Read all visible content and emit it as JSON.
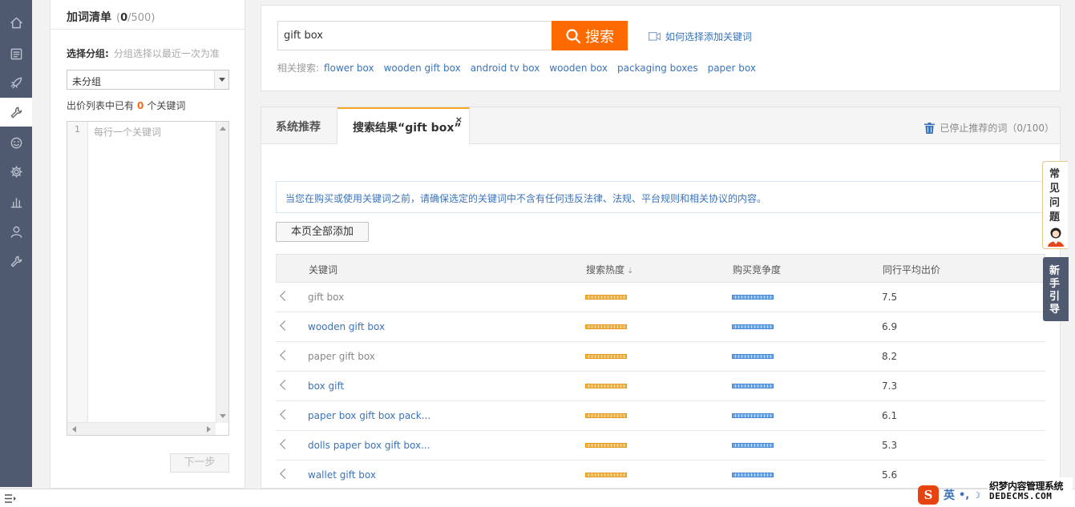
{
  "sidebar_rail": {
    "icons": [
      "home-icon",
      "list-icon",
      "rocket-icon",
      "wrench-icon",
      "face-icon",
      "gear-icon",
      "bar-chart-icon",
      "user-icon",
      "tools-icon"
    ],
    "active_index": 3
  },
  "left_panel": {
    "title": "加词清单",
    "count_open": "(",
    "count_current": "0",
    "count_total": "/500)",
    "group_label": "选择分组:",
    "group_hint": "分组选择以最近一次为准",
    "group_selected": "未分组",
    "bid_count_prefix": "出价列表中已有",
    "bid_count_value": "0",
    "bid_count_suffix": "个关键词",
    "line_number": "1",
    "keyword_placeholder": "每行一个关键词",
    "next_label": "下一步"
  },
  "search": {
    "query": "gift box",
    "button_label": "搜索",
    "help_link": "如何选择添加关键词",
    "related_label": "相关搜索:",
    "related": [
      "flower box",
      "wooden gift box",
      "android tv box",
      "wooden box",
      "packaging boxes",
      "paper box"
    ]
  },
  "tabs": {
    "recommend_label": "系统推荐",
    "results_label": "搜索结果“gift box”",
    "close_label": "×",
    "stopped_label": "已停止推荐的词（0/100）"
  },
  "notice": "当您在购买或使用关键词之前，请确保选定的关键词中不含有任何违反法律、法规、平台规则和相关协议的内容。",
  "add_all_label": "本页全部添加",
  "table": {
    "headers": {
      "keyword": "关键词",
      "heat": "搜索热度",
      "competition": "购买竞争度",
      "avg_bid": "同行平均出价"
    },
    "rows": [
      {
        "keyword": "gift box",
        "price": "7.5",
        "link": false
      },
      {
        "keyword": "wooden gift box",
        "price": "6.9",
        "link": true
      },
      {
        "keyword": "paper gift box",
        "price": "8.2",
        "link": false
      },
      {
        "keyword": "box gift",
        "price": "7.3",
        "link": true
      },
      {
        "keyword": "paper box gift box pack...",
        "price": "6.1",
        "link": true
      },
      {
        "keyword": "dolls paper box gift box...",
        "price": "5.3",
        "link": true
      },
      {
        "keyword": "wallet gift box",
        "price": "5.6",
        "link": true
      }
    ]
  },
  "float_tabs": {
    "faq": "常见问题",
    "guide": "新手引导"
  },
  "ime": {
    "logo": "S",
    "lang": "英",
    "punct": "•,",
    "moon": "☽"
  },
  "watermark": {
    "line1": "织梦内容管理系统",
    "line2": "DEDECMS.COM"
  },
  "colors": {
    "accent_orange": "#ff6a00",
    "link_blue": "#3b73b9",
    "rail_bg": "#4f5a70",
    "tab_active_border": "#f5a623"
  }
}
